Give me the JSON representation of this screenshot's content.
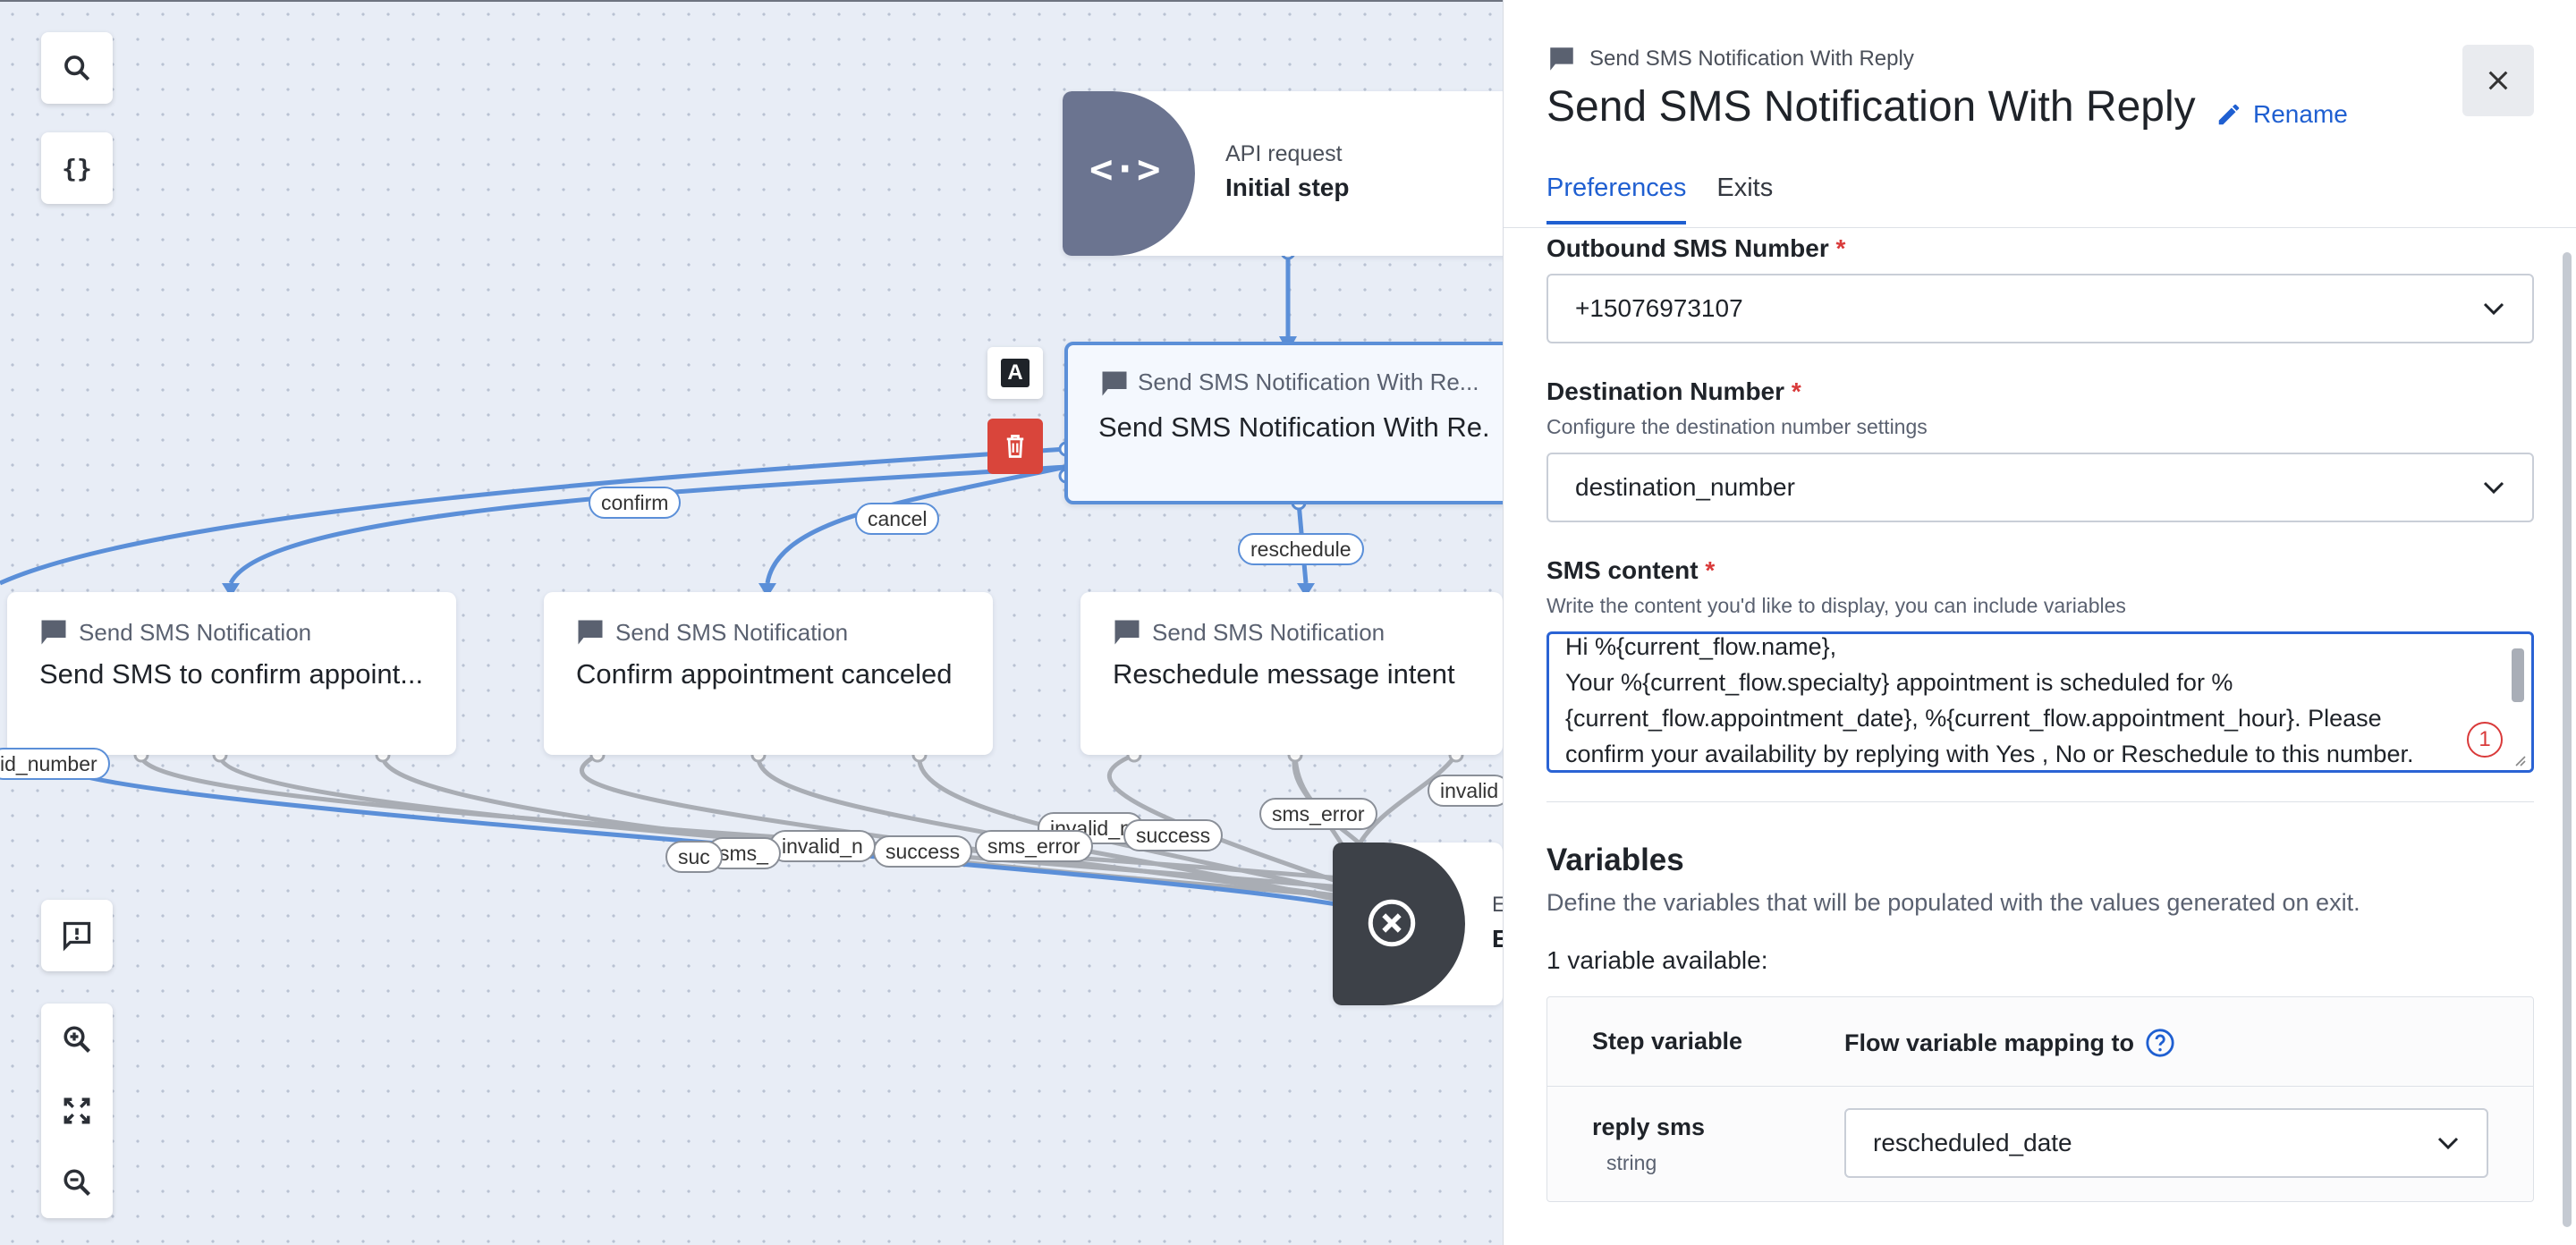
{
  "canvas": {
    "tools": {
      "search_icon": "search-icon",
      "variables_icon": "braces-icon",
      "feedback_icon": "feedback-icon",
      "zoom_in_icon": "zoom-in-icon",
      "fit_icon": "fit-screen-icon",
      "zoom_out_icon": "zoom-out-icon"
    },
    "nodes": {
      "api": {
        "type": "API request",
        "title": "Initial step"
      },
      "selected": {
        "type": "Send SMS Notification With Re...",
        "title": "Send SMS Notification With Re..."
      },
      "confirm": {
        "type": "Send SMS Notification",
        "title": "Send SMS to confirm appoint..."
      },
      "cancel": {
        "type": "Send SMS Notification",
        "title": "Confirm appointment canceled"
      },
      "reschedule": {
        "type": "Send SMS Notification",
        "title": "Reschedule message intent"
      },
      "end_short": "E",
      "end_title_short": "E"
    },
    "node_actions": {
      "annotate_label": "A"
    },
    "edge_labels": {
      "confirm": "confirm",
      "cancel": "cancel",
      "reschedule": "reschedule",
      "invalid_number": "id_number",
      "sms_error_1": "sms_error",
      "invalid_1": "invalid",
      "success_1": "success",
      "invalid_2": "invalid_n",
      "sms_error_2": "sms_error",
      "success_2": "success",
      "invalid_3": "invalid_n",
      "sms_short": "sms_",
      "suc_short": "suc"
    },
    "accent_color": "#5b8fd8",
    "edge_color": "#a9adb4"
  },
  "panel": {
    "breadcrumb": "Send SMS Notification With Reply",
    "title": "Send SMS Notification With Reply",
    "rename_label": "Rename",
    "close_icon": "close-icon",
    "tabs": [
      {
        "label": "Preferences",
        "active": true
      },
      {
        "label": "Exits",
        "active": false
      }
    ],
    "outbound": {
      "label": "Outbound SMS Number",
      "required": "*",
      "value": "+15076973107"
    },
    "destination": {
      "label": "Destination Number",
      "required": "*",
      "help": "Configure the destination number settings",
      "value": "destination_number"
    },
    "sms_content": {
      "label": "SMS content",
      "required": "*",
      "help": "Write the content you'd like to display, you can include variables",
      "lines": [
        "Hi %{current_flow.name},",
        "Your %{current_flow.specialty} appointment is scheduled for %",
        "{current_flow.appointment_date}, %{current_flow.appointment_hour}. Please",
        "confirm your availability by replying with Yes , No or Reschedule to this number."
      ],
      "issue_count": "1"
    },
    "variables": {
      "title": "Variables",
      "help": "Define the variables that will be populated with the values generated on exit.",
      "count_text": "1 variable available:",
      "col_step": "Step variable",
      "col_flow": "Flow variable mapping to",
      "rows": [
        {
          "name": "reply sms",
          "type": "string",
          "mapping": "rescheduled_date"
        }
      ]
    },
    "colors": {
      "accent": "#1f5fd1",
      "required": "#d93a3a"
    }
  }
}
